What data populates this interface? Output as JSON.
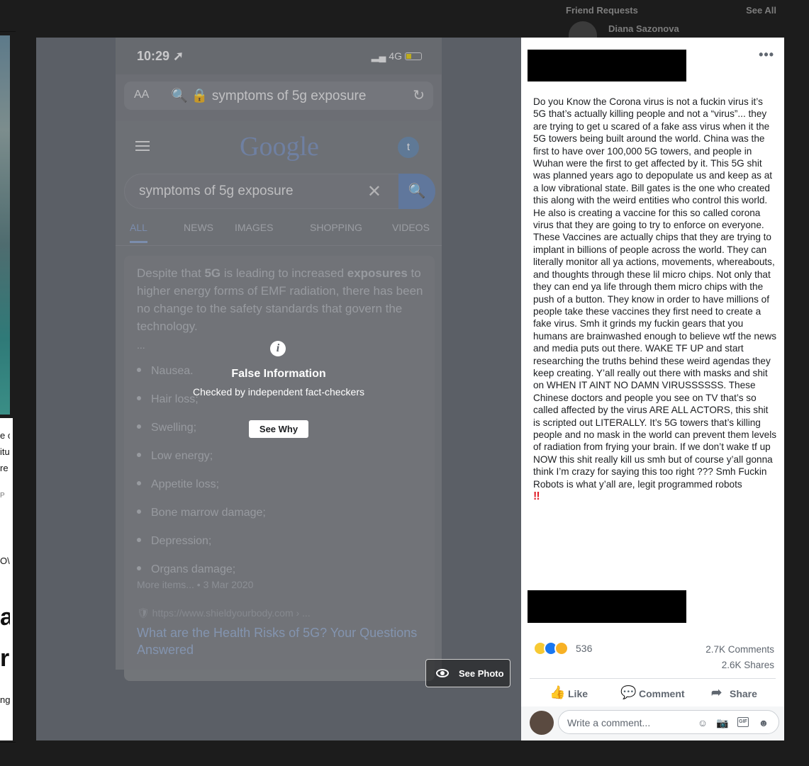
{
  "background": {
    "friend_requests_label": "Friend Requests",
    "see_all_label": "See All",
    "friend_name": "Diana Sazonova",
    "left_fragments": [
      "e c",
      "itu",
      "re",
      "P",
      "O\\",
      "a",
      "r",
      "ng"
    ]
  },
  "photo": {
    "status_time": "10:29 ➚",
    "network": "4G",
    "url_aa": "AA",
    "url_text": "🔍 🔒 symptoms of 5g exposure",
    "reload": "↻",
    "google_logo": "Google",
    "avatar_letter": "t",
    "search_query": "symptoms of 5g exposure",
    "search_clear": "✕",
    "search_btn": "🔍",
    "tabs": [
      "ALL",
      "NEWS",
      "IMAGES",
      "SHOPPING",
      "VIDEOS"
    ],
    "snippet_start": "Despite that ",
    "snippet_b1": "5G",
    "snippet_mid": " is leading to increased ",
    "snippet_b2": "exposures",
    "snippet_end": " to higher energy forms of EMF radiation, there has been no change to the safety standards that govern the technology.",
    "snippet_ellipsis": "...",
    "symptoms": [
      "Nausea.",
      "Hair loss;",
      "Swelling;",
      "Low energy;",
      "Appetite loss;",
      "Bone marrow damage;",
      "Depression;",
      "Organs damage;"
    ],
    "more_items": "More items... • 3 Mar 2020",
    "link_url": "🛡 https://www.shieldyourbody.com › ...",
    "link_title": "What are the Health Risks of 5G? Your Questions Answered"
  },
  "warning": {
    "icon": "i",
    "title": "False Information",
    "subtitle": "Checked by independent fact-checkers",
    "button": "See Why",
    "see_photo": "See Photo"
  },
  "post": {
    "more": "•••",
    "text": "Do you Know the Corona virus is not a fuckin virus it’s 5G that’s actually killing people and not a “virus”... they are trying to get u scared of a fake ass virus when it the 5G towers being built around the world. China was the first to have over 100,000 5G towers, and people in Wuhan were the first to get affected by it. This 5G shit was planned years ago to depopulate us and keep as at a low vibrational state. Bill gates is the one who created this along with the weird entities who control this world. He also is creating a vaccine for this so called corona virus that they are going to try to enforce on everyone. These Vaccines are actually chips that they are trying to implant in billions of people across the world. They can literally monitor all ya actions, movements, whereabouts, and thoughts through these lil micro chips. Not only that they can end ya life through them micro chips with the push of a button. They know in order to have millions of people take these vaccines they first need to create a fake virus. Smh it grinds my fuckin gears that you humans are brainwashed enough to believe wtf the news and media puts out there. WAKE TF UP and start researching the truths behind these weird agendas they keep creating. Y’all really out there with masks and shit on WHEN IT AINT NO DAMN VIRUSSSSSS. These Chinese doctors and people you see on TV that’s so called affected by the virus ARE ALL ACTORS, this shit is scripted out LITERALLY. It’s 5G towers that’s killing people and no mask in the world can prevent them levels of radiation from frying your brain. If we don’t wake tf up NOW this shit really kill us smh but of course y’all gonna think I’m crazy for saying this too right ??? Smh Fuckin Robots is what y’all are, legit programmed robots",
    "emoji_end": "‼",
    "reaction_count": "536",
    "comments": "2.7K Comments",
    "shares": "2.6K Shares",
    "like_label": "Like",
    "comment_label": "Comment",
    "share_label": "Share",
    "like_icon": "👍",
    "comment_icon": "💬",
    "share_icon": "➦",
    "comment_placeholder": "Write a comment...",
    "emoji_icon": "☺",
    "camera_icon": "📷",
    "gif_label": "GIF",
    "sticker_icon": "☻"
  },
  "colors": {
    "facebook_blue": "#1877f2",
    "panel_bg": "#ffffff",
    "overlay_bg": "#5b5f66"
  }
}
